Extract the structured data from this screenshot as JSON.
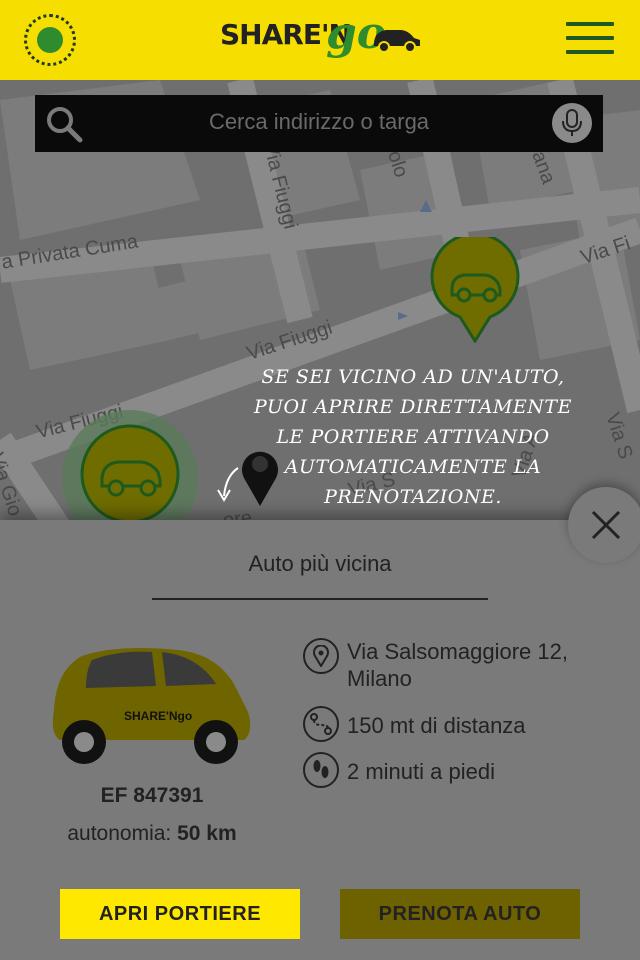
{
  "app": {
    "logo_text": "SHARE'N",
    "logo_accent": "go"
  },
  "search": {
    "placeholder": "Cerca indirizzo o targa"
  },
  "map": {
    "road_labels": [
      "a Privata Cuma",
      "Via Fiuggi",
      "Via Fiuggi",
      "Via Fiuggi",
      "olo",
      "ana",
      "Via Fi",
      "Via Gio",
      "ore",
      "Via S",
      "Via A",
      "Via S"
    ]
  },
  "tooltip": {
    "lines": [
      "SE SEI VICINO AD UN'AUTO,",
      "PUOI APRIRE DIRETTAMENTE",
      "LE PORTIERE ATTIVANDO",
      "AUTOMATICAMENTE LA",
      "PRENOTAZIONE."
    ]
  },
  "sheet": {
    "title": "Auto più vicina",
    "plate": "EF 847391",
    "range_label": "autonomia:",
    "range_value": "50 km",
    "address": "Via Salsomaggiore 12, Milano",
    "distance": "150 mt di distanza",
    "walk_time": "2 minuti a piedi",
    "car_decal": "SHARE'Ngo"
  },
  "buttons": {
    "open_doors": "APRI PORTIERE",
    "book_car": "PRENOTA AUTO"
  },
  "colors": {
    "header": "#f5de00",
    "brand_green": "#2e8b2e",
    "overlay": "#7a7a7a",
    "button_primary": "#ffe800",
    "button_dim": "#6e6100"
  }
}
